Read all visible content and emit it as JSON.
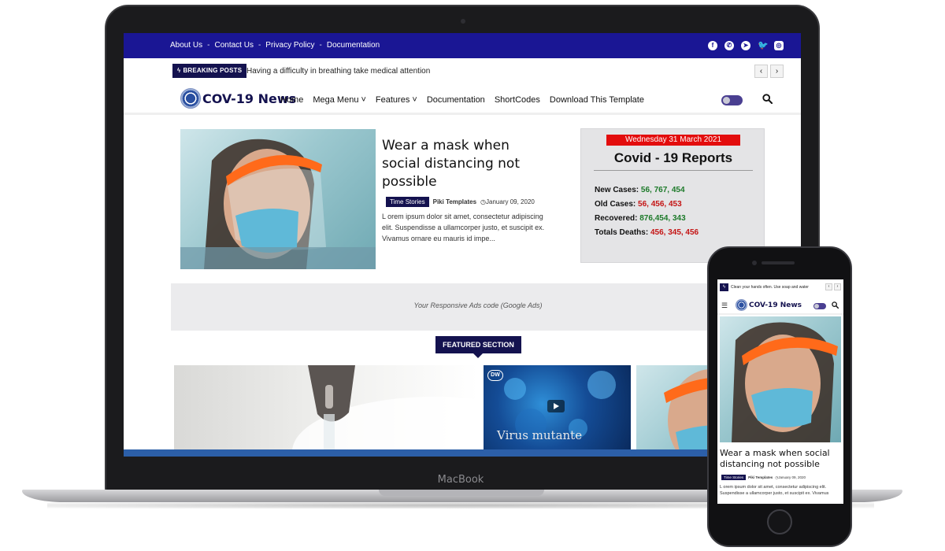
{
  "device": {
    "laptop_label": "MacBook"
  },
  "topbar": {
    "links": [
      "About Us",
      "Contact Us",
      "Privacy Policy",
      "Documentation"
    ],
    "social_icons": [
      "facebook-icon",
      "whatsapp-icon",
      "telegram-icon",
      "twitter-icon",
      "instagram-icon"
    ],
    "bg_color": "#1a1694"
  },
  "breaking": {
    "badge": "BREAKING POSTS",
    "ticker": "Having a difficulty in breathing take medical attention",
    "prev": "‹",
    "next": "›"
  },
  "header": {
    "logo": "COV-19 News",
    "menu": [
      "Home",
      "Mega Menu ˅",
      "Features ˅",
      "Documentation",
      "ShortCodes",
      "Download This Template"
    ]
  },
  "hero": {
    "title": "Wear a mask when social distancing not possible",
    "tag": "Time Stories",
    "author": "Piki Templates",
    "date": "◷January 09, 2020",
    "excerpt": "L orem ipsum dolor sit amet, consectetur adipiscing elit. Suspendisse a ullamcorper justo, et suscipit ex. Vivamus ornare eu mauris id impe..."
  },
  "report": {
    "date": "Wednesday 31 March 2021",
    "title": "Covid - 19 Reports",
    "rows": [
      {
        "label": "New Cases:",
        "value": "56, 767, 454",
        "color": "green"
      },
      {
        "label": "Old Cases:",
        "value": "56, 456, 453",
        "color": "red"
      },
      {
        "label": "Recovered:",
        "value": "876,454, 343",
        "color": "green"
      },
      {
        "label": "Totals Deaths:",
        "value": "456, 345, 456",
        "color": "red"
      }
    ]
  },
  "ads": {
    "text": "Your Responsive Ads code (Google Ads)"
  },
  "featured": {
    "label": "FEATURED SECTION",
    "video_caption": "Virus mutante",
    "video_logo": "DW"
  },
  "phone": {
    "ticker": "Clean your hands often. Use soap and water",
    "logo": "COV-19 News",
    "title": "Wear a mask when social distancing not possible",
    "tag": "Time Stories",
    "author": "Piki Templates",
    "date": "◷January 09, 2020",
    "excerpt": "L orem ipsum dolor sit amet, consectetur adipiscing elit. Suspendisse a ullamcorper justo, et suscipit ex. Vivamus"
  }
}
